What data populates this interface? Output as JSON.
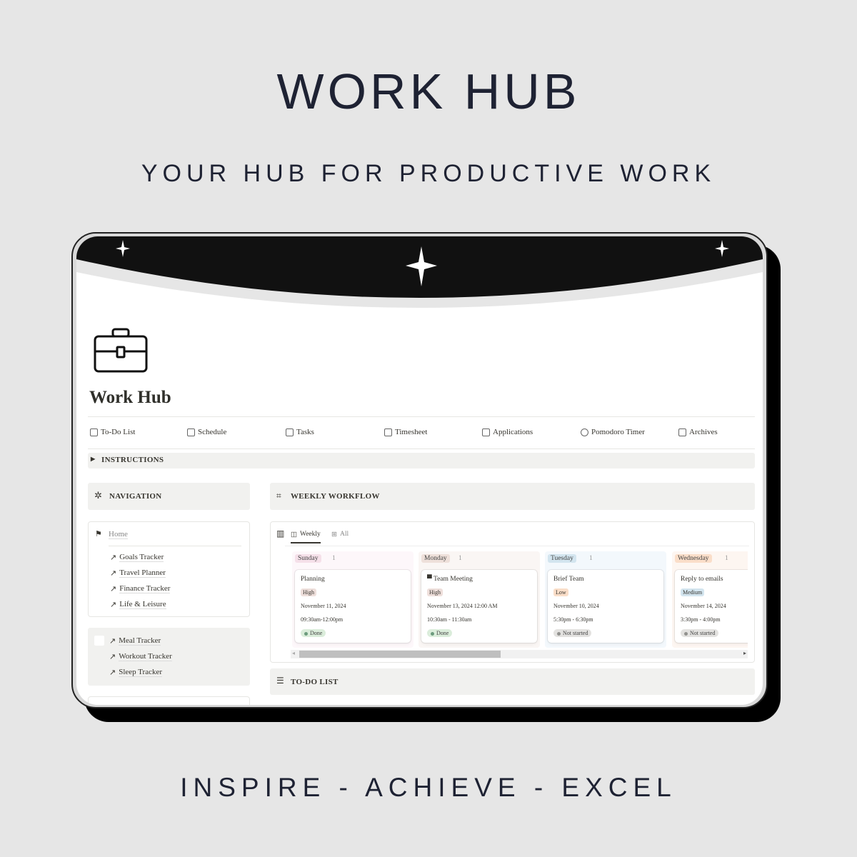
{
  "promo": {
    "title": "WORK HUB",
    "subtitle": "YOUR HUB FOR PRODUCTIVE WORK",
    "tagline": "INSPIRE - ACHIEVE - EXCEL"
  },
  "page": {
    "icon": "briefcase-icon",
    "title": "Work Hub"
  },
  "links": [
    {
      "label": "To-Do List",
      "icon": "note-icon"
    },
    {
      "label": "Schedule",
      "icon": "calendar-icon"
    },
    {
      "label": "Tasks",
      "icon": "checklist-icon"
    },
    {
      "label": "Timesheet",
      "icon": "timesheet-icon"
    },
    {
      "label": "Applications",
      "icon": "document-icon"
    },
    {
      "label": "Pomodoro Timer",
      "icon": "stopwatch-icon"
    },
    {
      "label": "Archives",
      "icon": "archive-icon"
    }
  ],
  "instructions": {
    "label": "INSTRUCTIONS"
  },
  "navigation": {
    "label": "NAVIGATION",
    "home": "Home",
    "items": [
      "Goals Tracker",
      "Travel  Planner",
      "Finance Tracker",
      "Life & Leisure"
    ],
    "items2": [
      "Meal Tracker",
      "Workout Tracker",
      "Sleep Tracker"
    ]
  },
  "weekly": {
    "label": "WEEKLY WORKFLOW",
    "tabs": [
      {
        "label": "Weekly",
        "active": true
      },
      {
        "label": "All",
        "active": false
      }
    ],
    "columns": [
      {
        "day": "Sunday",
        "count": "1",
        "day_bg": "#f5e0e9",
        "col_bg": "#fdf7fa",
        "card": {
          "name": "Planning",
          "priority": "High",
          "priority_bg": "#eedfdb",
          "date": "November 11, 2024",
          "time": "09:30am-12:00pm",
          "status": "Done",
          "status_bg": "#dbeddb",
          "status_dot": "#6c9b7d"
        }
      },
      {
        "day": "Monday",
        "count": "1",
        "day_bg": "#eee0da",
        "col_bg": "#faf6f4",
        "card": {
          "name": "Team Meeting",
          "priority": "High",
          "priority_bg": "#eedfdb",
          "date": "November 13, 2024 12:00 AM",
          "time": "10:30am - 11:30am",
          "status": "Done",
          "status_bg": "#dbeddb",
          "status_dot": "#6c9b7d"
        }
      },
      {
        "day": "Tuesday",
        "count": "1",
        "day_bg": "#d3e5ef",
        "col_bg": "#f3f8fc",
        "card": {
          "name": "Brief Team",
          "priority": "Low",
          "priority_bg": "#fadec9",
          "date": "November 10, 2024",
          "time": "5:30pm - 6:30pm",
          "status": "Not started",
          "status_bg": "#e3e2e0",
          "status_dot": "#91918e"
        }
      },
      {
        "day": "Wednesday",
        "count": "1",
        "day_bg": "#fadec9",
        "col_bg": "#fdf6f1",
        "card": {
          "name": "Reply to emails",
          "priority": "Medium",
          "priority_bg": "#d3e5ef",
          "date": "November 14, 2024",
          "time": "3:30pm - 4:00pm",
          "status": "Not started",
          "status_bg": "#e3e2e0",
          "status_dot": "#91918e"
        }
      }
    ]
  },
  "todo": {
    "label": "TO-DO LIST"
  }
}
